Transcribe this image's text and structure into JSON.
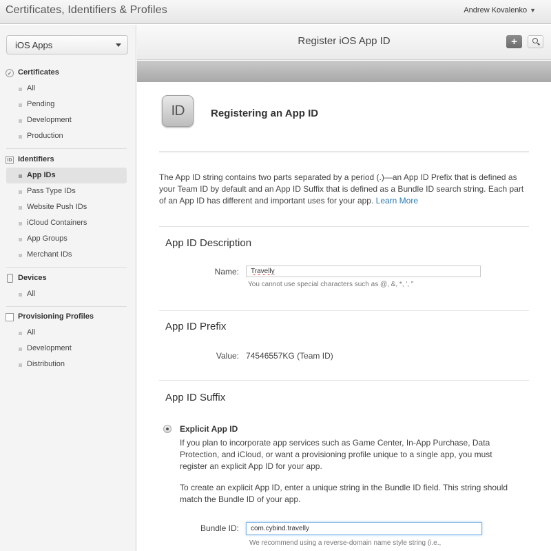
{
  "app": {
    "title": "Certificates, Identifiers & Profiles",
    "user": "Andrew Kovalenko"
  },
  "sidebar": {
    "platform": "iOS Apps",
    "sections": {
      "certificates": {
        "label": "Certificates",
        "items": [
          "All",
          "Pending",
          "Development",
          "Production"
        ]
      },
      "identifiers": {
        "label": "Identifiers",
        "items": [
          "App IDs",
          "Pass Type IDs",
          "Website Push IDs",
          "iCloud Containers",
          "App Groups",
          "Merchant IDs"
        ]
      },
      "devices": {
        "label": "Devices",
        "items": [
          "All"
        ]
      },
      "profiles": {
        "label": "Provisioning Profiles",
        "items": [
          "All",
          "Development",
          "Distribution"
        ]
      }
    },
    "active_item": "App IDs"
  },
  "header": {
    "title": "Register iOS App ID",
    "add_icon": "plus-icon",
    "search_icon": "search-icon"
  },
  "content": {
    "badge_text": "ID",
    "heading": "Registering an App ID",
    "intro": "The App ID string contains two parts separated by a period (.)—an App ID Prefix that is defined as your Team ID by default and an App ID Suffix that is defined as a Bundle ID search string. Each part of an App ID has different and important uses for your app.",
    "learn_more": "Learn More",
    "description": {
      "title": "App ID Description",
      "name_label": "Name:",
      "name_value": "Travelly",
      "name_hint": "You cannot use special characters such as @, &, *, ', \""
    },
    "prefix": {
      "title": "App ID Prefix",
      "value_label": "Value:",
      "value": "74546557KG (Team ID)"
    },
    "suffix": {
      "title": "App ID Suffix",
      "explicit_label": "Explicit App ID",
      "explicit_desc": "If you plan to incorporate app services such as Game Center, In-App Purchase, Data Protection, and iCloud, or want a provisioning profile unique to a single app, you must register an explicit App ID for your app.",
      "explicit_instr": "To create an explicit App ID, enter a unique string in the Bundle ID field. This string should match the Bundle ID of your app.",
      "bundle_label": "Bundle ID:",
      "bundle_value": "com.cybind.travelly",
      "bundle_hint": "We recommend using a reverse-domain name style string (i.e.,"
    }
  }
}
